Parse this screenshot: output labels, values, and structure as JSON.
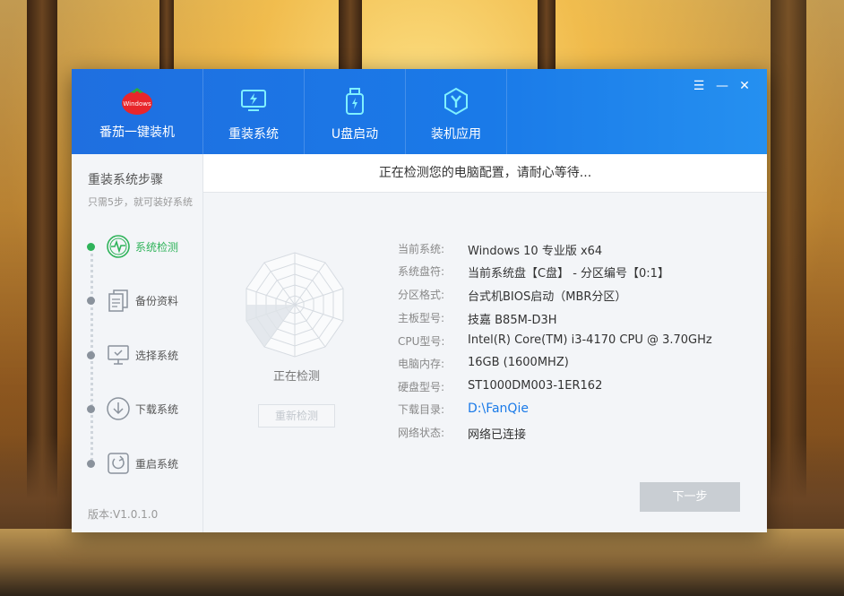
{
  "app": {
    "name": "番茄一键装机",
    "logo_text": "Windows"
  },
  "tabs": [
    {
      "label": "重装系统",
      "icon": "monitor-lightning-icon"
    },
    {
      "label": "U盘启动",
      "icon": "usb-drive-icon"
    },
    {
      "label": "装机应用",
      "icon": "app-hexagon-icon"
    }
  ],
  "sidebar": {
    "title": "重装系统步骤",
    "subtitle": "只需5步，就可装好系统",
    "steps": [
      {
        "label": "系统检测",
        "icon": "pulse-circle-icon",
        "active": true
      },
      {
        "label": "备份资料",
        "icon": "documents-icon",
        "active": false
      },
      {
        "label": "选择系统",
        "icon": "monitor-select-icon",
        "active": false
      },
      {
        "label": "下载系统",
        "icon": "download-circle-icon",
        "active": false
      },
      {
        "label": "重启系统",
        "icon": "restart-icon",
        "active": false
      }
    ],
    "version": "版本:V1.0.1.0"
  },
  "main": {
    "header": "正在检测您的电脑配置，请耐心等待...",
    "detecting_label": "正在检测",
    "retry_label": "重新检测",
    "next_label": "下一步",
    "info": [
      {
        "key": "当前系统:",
        "value": "Windows 10 专业版 x64"
      },
      {
        "key": "系统盘符:",
        "value": "当前系统盘【C盘】 - 分区编号【0:1】"
      },
      {
        "key": "分区格式:",
        "value": "台式机BIOS启动（MBR分区）"
      },
      {
        "key": "主板型号:",
        "value": "技嘉 B85M-D3H"
      },
      {
        "key": "CPU型号:",
        "value": "Intel(R) Core(TM) i3-4170 CPU @ 3.70GHz"
      },
      {
        "key": "电脑内存:",
        "value": "16GB (1600MHZ)"
      },
      {
        "key": "硬盘型号:",
        "value": "ST1000DM003-1ER162"
      },
      {
        "key": "下载目录:",
        "value": "D:\\FanQie"
      },
      {
        "key": "网络状态:",
        "value": "网络已连接"
      }
    ]
  },
  "colors": {
    "accent": "#1a7ae8",
    "active_step": "#2fb35a",
    "titlebar": "#1f6fe0"
  }
}
